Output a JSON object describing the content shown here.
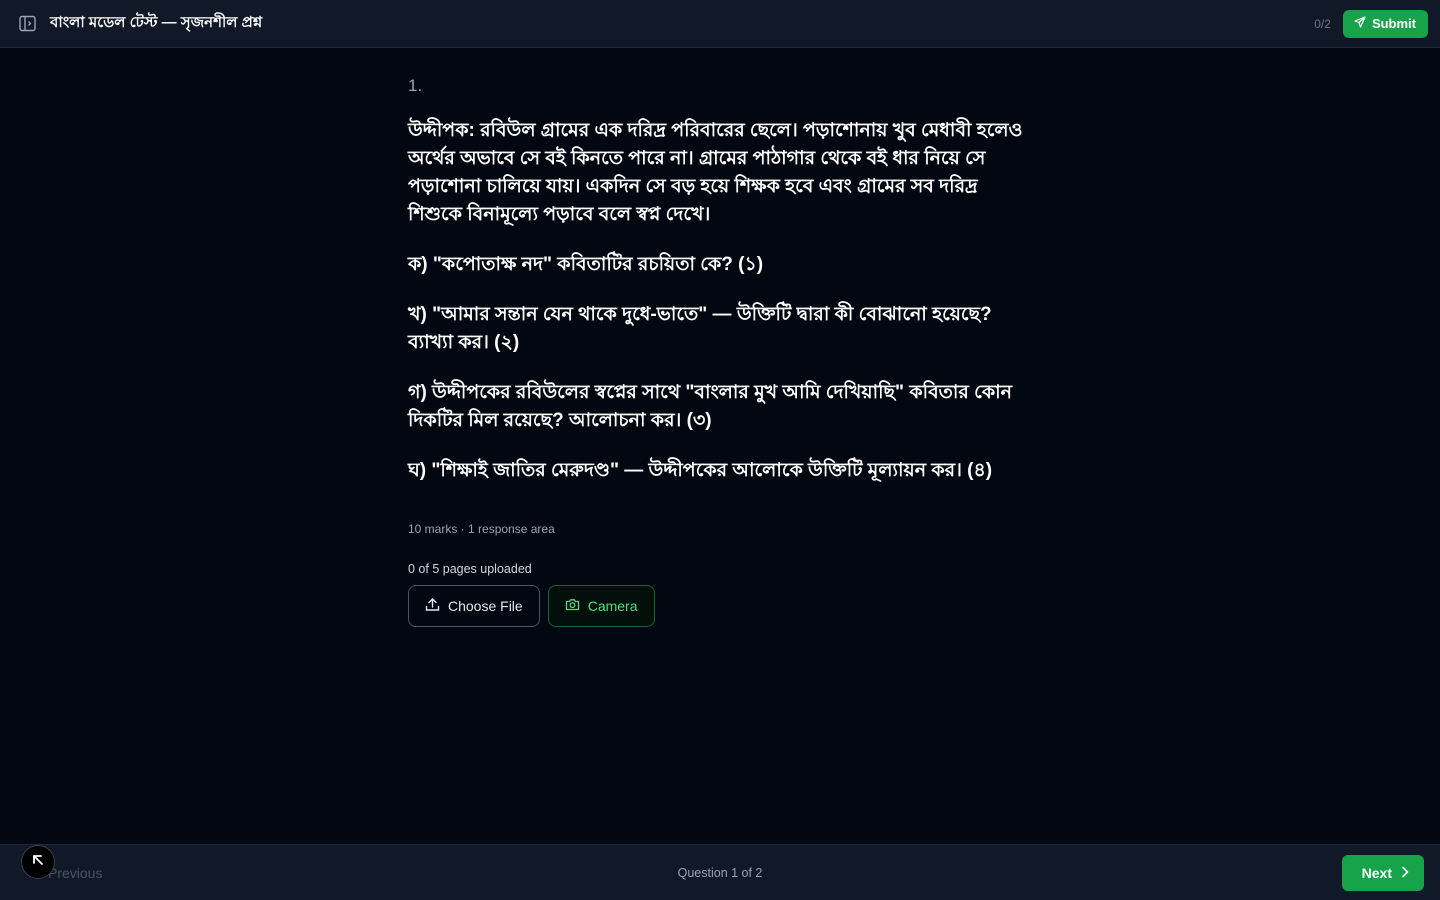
{
  "header": {
    "title": "বাংলা মডেল টেস্ট — সৃজনশীল প্রশ্ন",
    "progress": "0/2",
    "submit_label": "Submit",
    "sidebar_icon": "sidebar-toggle-icon",
    "submit_icon": "send-icon"
  },
  "question": {
    "number": "1.",
    "stimulus": "উদ্দীপক: রবিউল গ্রামের এক দরিদ্র পরিবারের ছেলে। পড়াশোনায় খুব মেধাবী হলেও অর্থের অভাবে সে বই কিনতে পারে না। গ্রামের পাঠাগার থেকে বই ধার নিয়ে সে পড়াশোনা চালিয়ে যায়। একদিন সে বড় হয়ে শিক্ষক হবে এবং গ্রামের সব দরিদ্র শিশুকে বিনামূল্যে পড়াবে বলে স্বপ্ন দেখে।",
    "sub_questions": [
      "ক) \"কপোতাক্ষ নদ\" কবিতাটির রচয়িতা কে? (১)",
      "খ) \"আমার সন্তান যেন থাকে দুধে-ভাতে\" — উক্তিটি দ্বারা কী বোঝানো হয়েছে? ব্যাখ্যা কর। (২)",
      "গ) উদ্দীপকের রবিউলের স্বপ্নের সাথে \"বাংলার মুখ আমি দেখিয়াছি\" কবিতার কোন দিকটির মিল রয়েছে? আলোচনা কর। (৩)",
      "ঘ) \"শিক্ষাই জাতির মেরুদণ্ড\" — উদ্দীপকের আলোকে উক্তিটি মূল্যায়ন কর। (৪)"
    ],
    "meta": "10 marks · 1 response area"
  },
  "upload": {
    "status": "0 of 5 pages uploaded",
    "choose_file_label": "Choose File",
    "camera_label": "Camera",
    "upload_icon": "upload-icon",
    "camera_icon": "camera-icon"
  },
  "footer": {
    "previous_label": "Previous",
    "indicator": "Question 1 of 2",
    "next_label": "Next",
    "next_icon": "chevron-right-icon"
  },
  "colors": {
    "background": "#030712",
    "surface": "#111827",
    "accent": "#16a34a",
    "accent_text": "#4ade80"
  }
}
